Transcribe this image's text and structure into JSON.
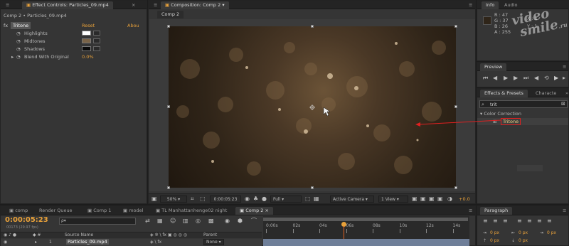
{
  "top_tabs": {
    "effect_controls": "Effect Controls: Particles_09.mp4",
    "composition": "Composition: Comp 2",
    "info": "Info",
    "audio": "Audio"
  },
  "effect_controls": {
    "breadcrumb": "Comp 2 • Particles_09.mp4",
    "effect_name": "Tritone",
    "reset": "Reset",
    "about": "Abou",
    "props": [
      {
        "label": "Highlights",
        "color": "#ffffff"
      },
      {
        "label": "Midtones",
        "color": "#7a6448"
      },
      {
        "label": "Shadows",
        "color": "#0a0a0a"
      }
    ],
    "blend_label": "Blend With Original",
    "blend_value": "0.0%"
  },
  "composition": {
    "subtab": "Comp 2",
    "zoom": "50%",
    "timecode": "0:00:05:23",
    "resolution": "Full",
    "camera": "Active Camera",
    "view": "1 View",
    "exposure": "+0.0"
  },
  "info": {
    "r": "R : 47",
    "g": "G : 37",
    "b": "B : 26",
    "a": "A : 255",
    "x": "X : 1",
    "y": "Y : 1",
    "swatch": "#2f2519"
  },
  "watermark": {
    "line1": "video",
    "line2": "smile",
    "suffix": ".ru"
  },
  "preview": {
    "title": "Preview"
  },
  "effects_presets": {
    "tab": "Effects & Presets",
    "tab2": "Characte",
    "search_value": "trit",
    "category": "Color Correction",
    "item": "Tritone"
  },
  "paragraph": {
    "title": "Paragraph",
    "values": [
      "0 px",
      "0 px",
      "0 px",
      "0 px",
      "0 px"
    ]
  },
  "timeline": {
    "tabs": [
      "comp",
      "Render Queue",
      "Comp 1",
      "model",
      "TL Manhattanhenge02 night",
      "Comp 2"
    ],
    "timecode": "0:00:05:23",
    "subtime": "00173 (29.97 fps)",
    "search_placeholder": "ρ▾",
    "source_name_header": "Source Name",
    "parent_header": "Parent",
    "layer_index": "1",
    "layer_name": "Particles_09.mp4",
    "layer_parent": "None",
    "ticks": [
      "0:00s",
      "02s",
      "04s",
      "06s",
      "08s",
      "10s",
      "12s",
      "14s"
    ]
  }
}
